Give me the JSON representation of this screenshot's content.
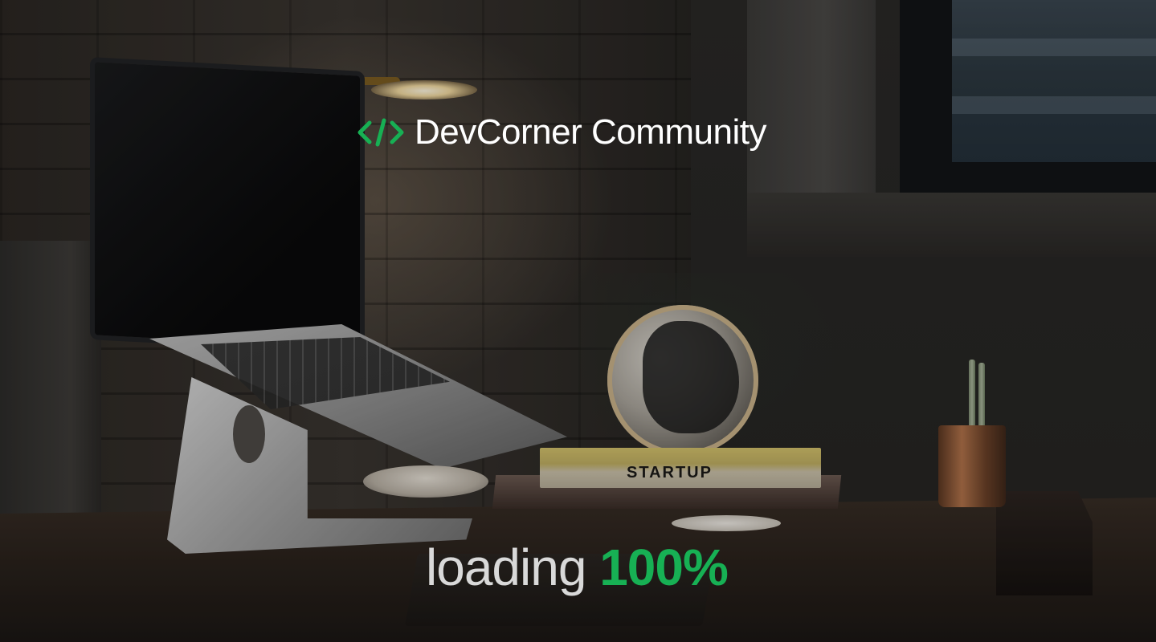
{
  "brand": {
    "name": "DevCorner Community",
    "logo_icon": "code-brackets-icon",
    "accent_color": "#17b054"
  },
  "loader": {
    "label": "loading",
    "percent_text": "100%",
    "progress": 100,
    "label_color": "#d9d9d9",
    "percent_color": "#17b054"
  },
  "background": {
    "book_title": "STARTUP"
  }
}
